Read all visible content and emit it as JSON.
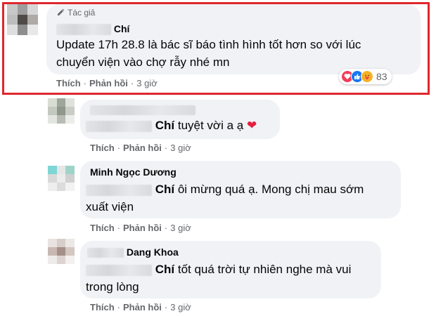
{
  "comments": [
    {
      "author_suffix": "Chí",
      "badge_label": "Tác giả",
      "text_line1": "Update 17h 28.8 là bác sĩ báo tình hình tốt hơn so với lúc",
      "text_line2": "chuyển viện vào chợ rẫy nhé mn",
      "reaction_count": "83",
      "actions": {
        "like": "Thích",
        "reply": "Phản hồi",
        "time": "3 giờ"
      }
    },
    {
      "tag_name": "Chí",
      "text": " tuyệt vời a ạ ",
      "heart": "❤",
      "actions": {
        "like": "Thích",
        "reply": "Phản hồi",
        "time": "3 giờ"
      }
    },
    {
      "author": "Minh Ngọc Dương",
      "tag_name": "Chí",
      "text_line1": " ôi mừng quá ạ. Mong chị mau sớm",
      "text_line2": "xuất viện",
      "actions": {
        "like": "Thích",
        "reply": "Phản hồi",
        "time": "3 giờ"
      }
    },
    {
      "author": "Dang Khoa",
      "tag_name": "Chí",
      "text_line1": " tốt quá trời tự nhiên nghe mà vui",
      "text_line2": "trong lòng",
      "actions": {
        "like": "Thích",
        "reply": "Phản hồi",
        "time": "3 giờ"
      }
    }
  ],
  "colors": {
    "highlight": "#e0262d",
    "bubble": "#f0f2f5",
    "meta": "#65676b",
    "heart": "#e41e3f",
    "like_blue": "#1877f2",
    "care_yellow": "#f7b125"
  }
}
